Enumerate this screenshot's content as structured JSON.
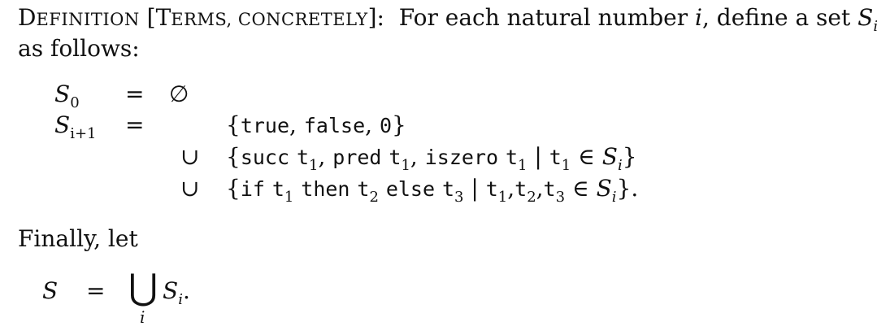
{
  "definition": {
    "label_first": "D",
    "label_rest": "EFINITION",
    "bracket_open": "[",
    "terms_first": "T",
    "terms_rest": "ERMS, CONCRETELY",
    "bracket_close": "]:",
    "intro_text": "For each natural number",
    "var_i": "i",
    "intro_text2": ", define a set",
    "set_S": "S",
    "sub_i": "i",
    "line2": "as follows:"
  },
  "equations": {
    "row0": {
      "lhs": "S",
      "lhs_sub": "0",
      "eq": "=",
      "rhs": "∅"
    },
    "row1": {
      "lhs": "S",
      "lhs_sub": "i+1",
      "eq": "=",
      "open": "{",
      "true": "true",
      "comma1": ",",
      "false": "false",
      "comma2": ",",
      "zero": "0",
      "close": "}"
    },
    "row2": {
      "union": "∪",
      "open": "{",
      "succ": "succ",
      "t": "t",
      "s1": "1",
      "comma1": ",",
      "pred": "pred",
      "comma2": ",",
      "iszero": "iszero",
      "bar": "|",
      "in": "∈",
      "S": "S",
      "i": "i",
      "close": "}"
    },
    "row3": {
      "union": "∪",
      "open": "{",
      "if": "if",
      "t": "t",
      "s1": "1",
      "then": "then",
      "s2": "2",
      "else": "else",
      "s3": "3",
      "bar": "|",
      "comma": ",",
      "in": "∈",
      "S": "S",
      "i": "i",
      "close": "}."
    }
  },
  "finally": {
    "text": "Finally, let"
  },
  "final_eq": {
    "lhs": "S",
    "eq": "=",
    "bigcup": "⋃",
    "under": "i",
    "S": "S",
    "i": "i",
    "period": "."
  }
}
